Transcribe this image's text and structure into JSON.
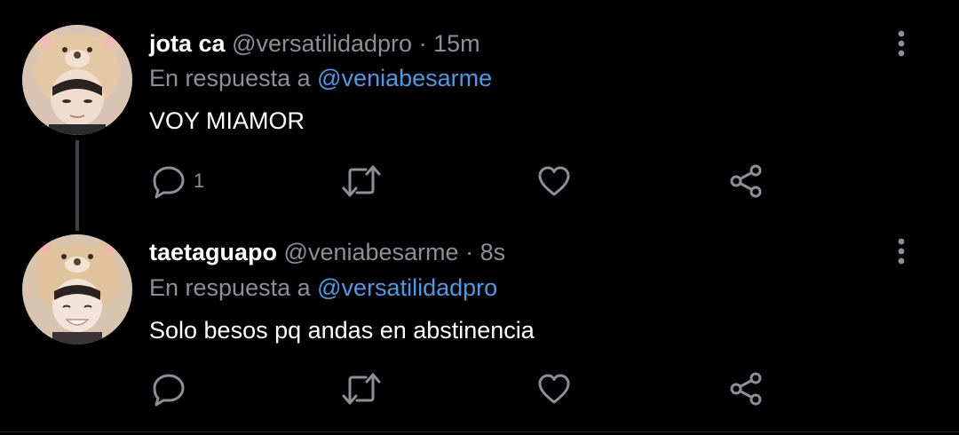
{
  "tweets": [
    {
      "name": "jota ca",
      "handle": "@versatilidadpro",
      "separator": "·",
      "time": "15m",
      "reply_prefix": "En respuesta a",
      "reply_mention": "@veniabesarme",
      "text": "VOY MIAMOR",
      "reply_count": "1"
    },
    {
      "name": "taetaguapo",
      "handle": "@veniabesarme",
      "separator": "·",
      "time": "8s",
      "reply_prefix": "En respuesta a",
      "reply_mention": "@versatilidadpro",
      "text": "Solo besos pq andas en abstinencia",
      "reply_count": ""
    }
  ],
  "colors": {
    "background": "#000000",
    "secondary_text": "#8b9095",
    "mention": "#4a9ae6",
    "icon": "#8b9095"
  },
  "icons": [
    "reply-icon",
    "retweet-icon",
    "like-icon",
    "share-icon",
    "more-options-icon"
  ]
}
